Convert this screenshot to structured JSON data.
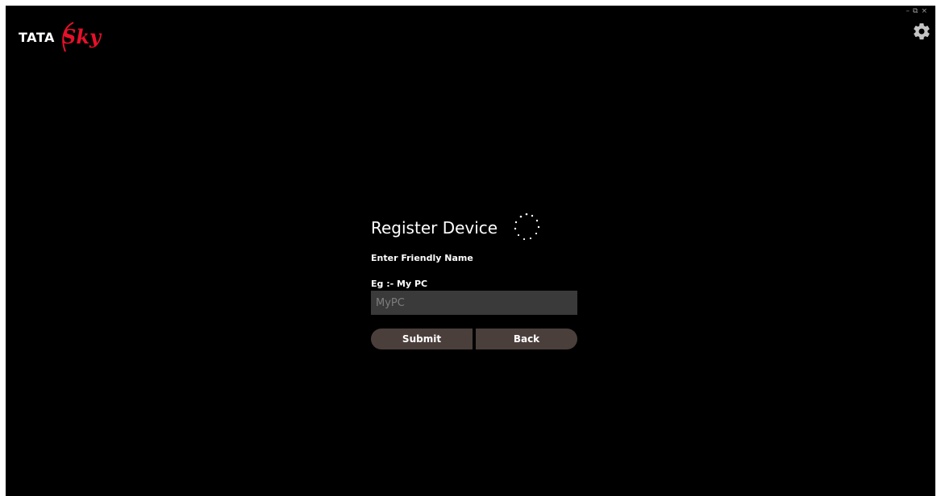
{
  "brand": {
    "logo_text_primary": "TATA",
    "logo_text_secondary": "Sky",
    "colors": {
      "logo_red": "#e8102a",
      "background": "#000000",
      "button_bg": "#4b3f3c",
      "input_bg": "#3a3a3a"
    }
  },
  "window_controls": {
    "minimize": "–",
    "restore": "⧉",
    "close": "×"
  },
  "header": {
    "settings_icon": "gear-icon"
  },
  "register": {
    "title": "Register Device",
    "loading_icon": "spinner-icon",
    "friendly_name_label": "Enter Friendly Name",
    "example_label": "Eg :- My PC",
    "name_input": {
      "value": "",
      "placeholder": "MyPC"
    },
    "submit_label": "Submit",
    "back_label": "Back"
  }
}
